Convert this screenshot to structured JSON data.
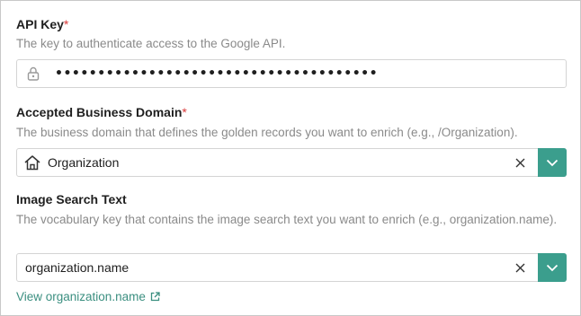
{
  "api_key": {
    "label": "API Key",
    "required_mark": "*",
    "description": "The key to authenticate access to the Google API.",
    "masked_value": "••••••••••••••••••••••••••••••••••••••",
    "icon": "lock-icon"
  },
  "business_domain": {
    "label": "Accepted Business Domain",
    "required_mark": "*",
    "description": "The business domain that defines the golden records you want to enrich (e.g., /Organization).",
    "value": "Organization",
    "icon": "home-icon"
  },
  "image_search": {
    "label": "Image Search Text",
    "description": "The vocabulary key that contains the image search text you want to enrich (e.g., organization.name).",
    "value": "organization.name",
    "link_text": "View organization.name"
  },
  "colors": {
    "accent": "#3b9e8d",
    "link": "#3b8f80",
    "required": "#d93a3a",
    "description": "#8a8a8a"
  }
}
